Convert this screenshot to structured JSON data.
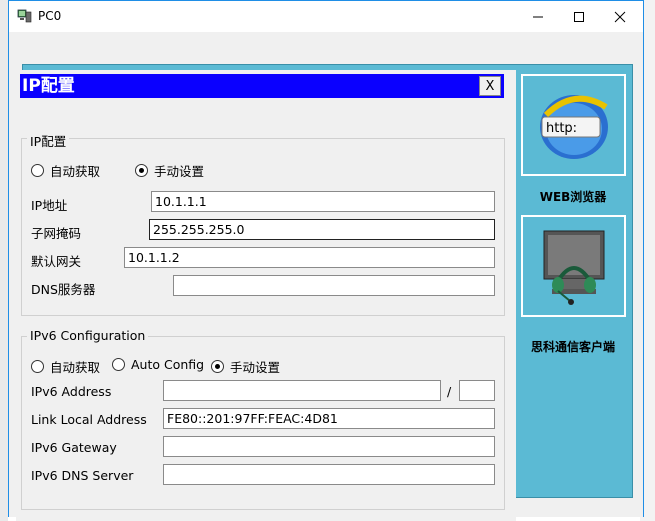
{
  "window": {
    "title": "PC0"
  },
  "dialog": {
    "title": "IP配置",
    "close_label": "X",
    "ipv4": {
      "legend": "IP配置",
      "radio_dhcp": "自动获取",
      "radio_static": "手动设置",
      "mode": "static",
      "ip_label": "IP地址",
      "ip_value": "10.1.1.1",
      "mask_label": "子网掩码",
      "mask_value": "255.255.255.0",
      "gateway_label": "默认网关",
      "gateway_value": "10.1.1.2",
      "dns_label": "DNS服务器",
      "dns_value": ""
    },
    "ipv6": {
      "legend": "IPv6 Configuration",
      "radio_dhcp": "自动获取",
      "radio_auto": "Auto Config",
      "radio_static": "手动设置",
      "mode": "static",
      "address_label": "IPv6 Address",
      "address_value": "",
      "prefix_sep": "/",
      "prefix_value": "",
      "link_local_label": "Link Local Address",
      "link_local_value": "FE80::201:97FF:FEAC:4D81",
      "gateway_label": "IPv6 Gateway",
      "gateway_value": "",
      "dns_label": "IPv6 DNS Server",
      "dns_value": ""
    }
  },
  "side_apps": {
    "web_browser": {
      "label": "WEB浏览器",
      "icon_text": "http:"
    },
    "cisco_client": {
      "label": "思科通信客户端"
    }
  },
  "colors": {
    "dialog_title_bg": "#0a00ff",
    "desktop_panel": "#5bbad4",
    "window_border": "#1f8ee6"
  }
}
